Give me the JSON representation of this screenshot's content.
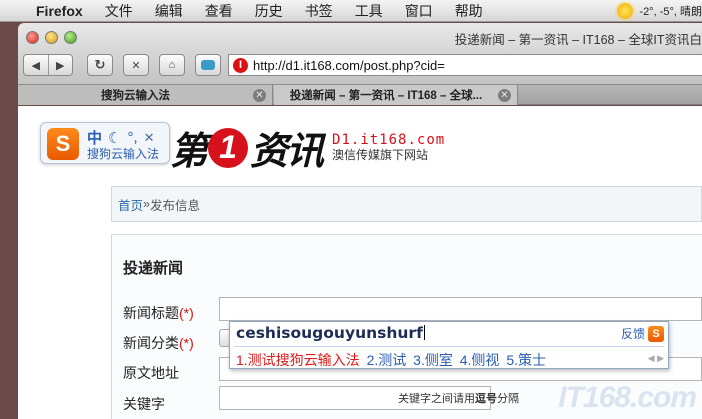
{
  "menubar": {
    "app": "Firefox",
    "items": [
      "文件",
      "编辑",
      "查看",
      "历史",
      "书签",
      "工具",
      "窗口",
      "帮助"
    ],
    "weather": "-2°, -5°, 晴朗"
  },
  "window": {
    "title": "投递新闻 – 第一资讯 – IT168 – 全球IT资讯白"
  },
  "toolbar": {
    "url": "http://d1.it168.com/post.php?cid="
  },
  "tabs": [
    {
      "label": "搜狗云输入法"
    },
    {
      "label": "投递新闻 – 第一资讯 – IT168 – 全球..."
    }
  ],
  "page": {
    "logo": {
      "part1": "第",
      "badge": "1",
      "part2": "资讯",
      "domain": "D1.it168.com",
      "tagline": "澳信传媒旗下网站"
    },
    "breadcrumb": {
      "home": "首页",
      "sep": " » ",
      "current": "发布信息"
    },
    "form": {
      "title": "投递新闻",
      "fields": [
        {
          "label": "新闻标题",
          "required_mark": "(*)"
        },
        {
          "label": "新闻分类",
          "required_mark": "(*)"
        },
        {
          "label": "原文地址"
        },
        {
          "label": "关键字"
        }
      ],
      "keyword_hint_pre": "关键字之间请用",
      "keyword_hint_bold": "逗号",
      "keyword_hint_post": "分隔"
    },
    "watermark": "IT168.com"
  },
  "ime_float": {
    "logo": "S",
    "mode": "中",
    "name": "搜狗云输入法"
  },
  "ime_popup": {
    "input": "ceshisougouyunshurf",
    "feedback": "反馈",
    "candidates": [
      "1.测试搜狗云输入法",
      "2.测试",
      "3.侧室",
      "4.侧视",
      "5.策士"
    ]
  }
}
